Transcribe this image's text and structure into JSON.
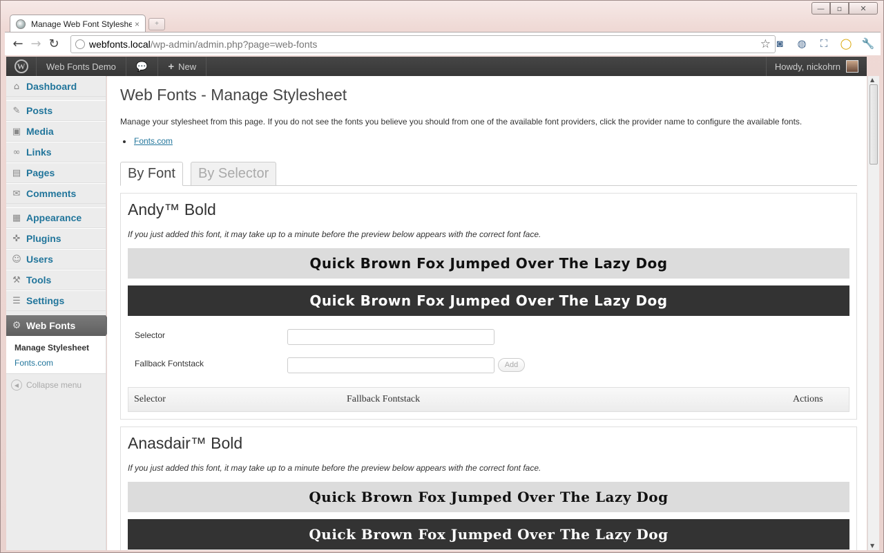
{
  "browser": {
    "tab_title": "Manage Web Font Stylesheet",
    "tab_close": "×",
    "newtab": "+",
    "url_domain": "webfonts.local",
    "url_path": "/wp-admin/admin.php?page=web-fonts",
    "winctl": {
      "min": "—",
      "max": "▫",
      "close": "✕"
    }
  },
  "adminbar": {
    "site_name": "Web Fonts Demo",
    "new_label": "New",
    "howdy": "Howdy, nickohrn"
  },
  "sidebar": {
    "items": [
      {
        "label": "Dashboard",
        "icon": "⌂"
      },
      {
        "label": "Posts",
        "icon": "✎"
      },
      {
        "label": "Media",
        "icon": "▣"
      },
      {
        "label": "Links",
        "icon": "∞"
      },
      {
        "label": "Pages",
        "icon": "▤"
      },
      {
        "label": "Comments",
        "icon": "✉"
      },
      {
        "label": "Appearance",
        "icon": "▦"
      },
      {
        "label": "Plugins",
        "icon": "✜"
      },
      {
        "label": "Users",
        "icon": "☺"
      },
      {
        "label": "Tools",
        "icon": "⚒"
      },
      {
        "label": "Settings",
        "icon": "☰"
      }
    ],
    "active": "Web Fonts",
    "submenu": [
      "Manage Stylesheet",
      "Fonts.com"
    ],
    "collapse": "Collapse menu"
  },
  "main": {
    "title": "Web Fonts - Manage Stylesheet",
    "description": "Manage your stylesheet from this page. If you do not see the fonts you believe you should from one of the available font providers, click the provider name to configure the available fonts.",
    "provider": "Fonts.com",
    "tabs": [
      "By Font",
      "By Selector"
    ],
    "note": "If you just added this font, it may take up to a minute before the preview below appears with the correct font face.",
    "preview_text": "Quick Brown Fox Jumped Over The Lazy Dog",
    "fonts": [
      {
        "name": "Andy™ Bold"
      },
      {
        "name": "Anasdair™ Bold"
      }
    ],
    "form": {
      "selector_label": "Selector",
      "fallback_label": "Fallback Fontstack",
      "add_label": "Add"
    },
    "table_headers": [
      "Selector",
      "Fallback Fontstack",
      "Actions"
    ]
  }
}
